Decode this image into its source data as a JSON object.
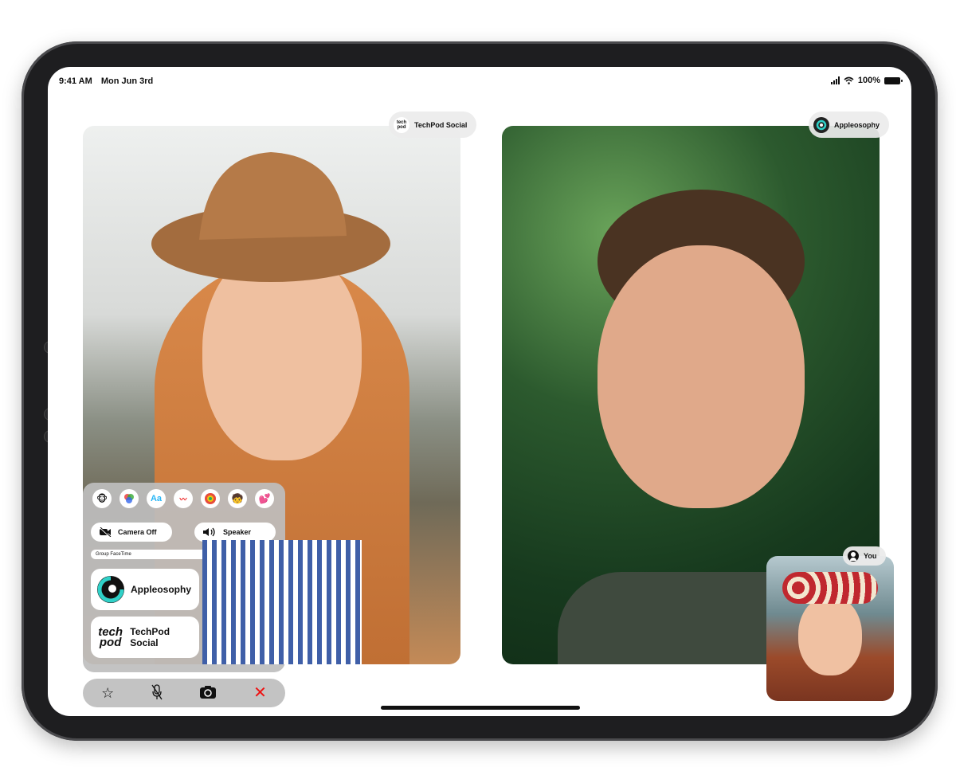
{
  "status": {
    "time": "9:41 AM",
    "date": "Mon Jun 3rd",
    "battery": "100%"
  },
  "tiles": {
    "left": {
      "label": "TechPod Social",
      "logo_text": "tech pod"
    },
    "right": {
      "label": "Appleosophy"
    },
    "self": {
      "label": "You"
    }
  },
  "panel": {
    "effects": [
      "memoji-icon",
      "color-filter-icon",
      "text-icon",
      "shapes-icon",
      "sticker-icon",
      "emoji-icon",
      "hearts-icon"
    ],
    "effects_text": {
      "text": "Aa"
    },
    "camera_off": "Camera Off",
    "speaker": "Speaker",
    "group_facetime": "Group FaceTime",
    "contacts": [
      {
        "name": "Appleosophy"
      },
      {
        "name": "TechPod Social",
        "logo_text_top": "tech",
        "logo_text_bottom": "pod"
      }
    ]
  },
  "toolbar": {
    "items": [
      "effects-icon",
      "mute-icon",
      "flip-camera-icon",
      "end-call-icon"
    ]
  }
}
